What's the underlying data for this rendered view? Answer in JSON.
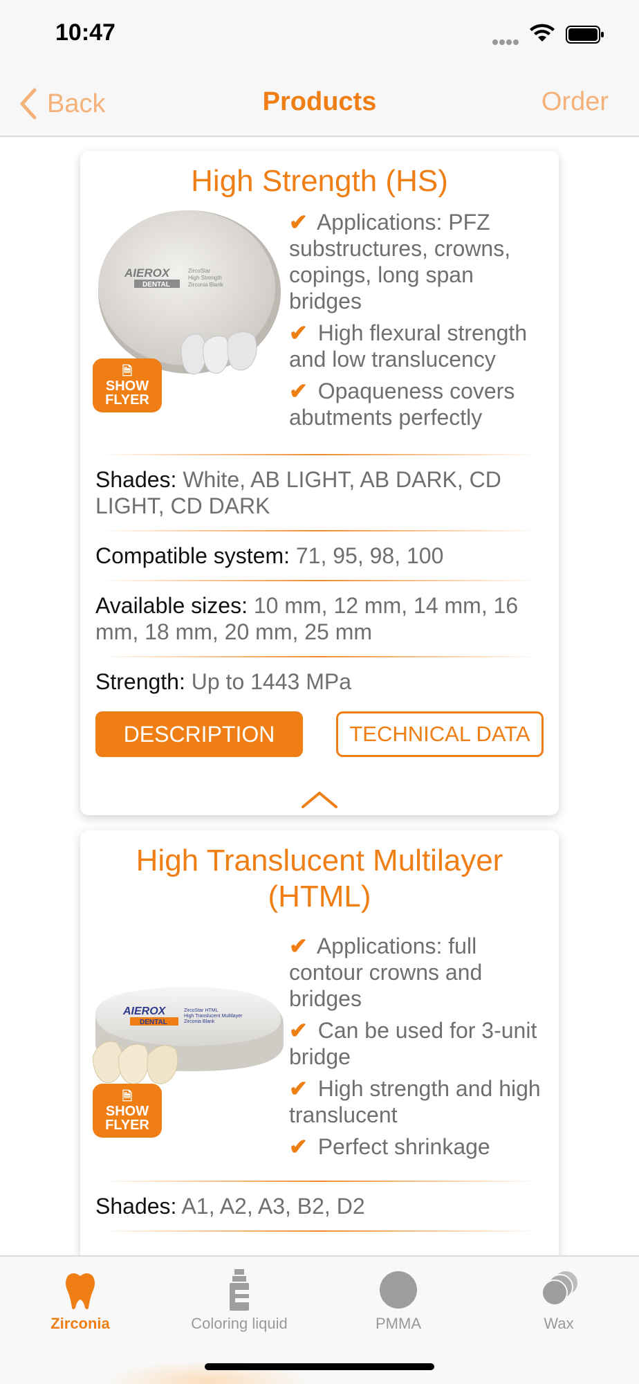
{
  "status_bar": {
    "time": "10:47"
  },
  "nav": {
    "back_label": "Back",
    "title": "Products",
    "order_label": "Order"
  },
  "colors": {
    "accent": "#ef7e14",
    "accent_light": "#f4b27a",
    "muted_text": "#6f6f6f"
  },
  "products": [
    {
      "title": "High Strength (HS)",
      "features": [
        "Applications: PFZ substructures, crowns, copings, long span bridges",
        "High flexural strength and low translucency",
        "Opaqueness covers abutments perfectly"
      ],
      "flyer_label": [
        "SHOW",
        "FLYER"
      ],
      "image_text": {
        "brand": "AIEROX",
        "sub": "DENTAL",
        "lines": [
          "ZircoStar",
          "High Strength",
          "Zirconia Blank"
        ]
      },
      "specs": [
        {
          "label": "Shades:",
          "value": "White, AB LIGHT, AB DARK, CD LIGHT, CD DARK"
        },
        {
          "label": "Compatible system:",
          "value": "71, 95, 98, 100"
        },
        {
          "label": "Available sizes:",
          "value": "10 mm, 12 mm, 14 mm, 16 mm, 18 mm, 20 mm, 25 mm"
        },
        {
          "label": "Strength:",
          "value": "Up to 1443 MPa"
        }
      ],
      "description_label": "DESCRIPTION",
      "technical_label": "TECHNICAL DATA"
    },
    {
      "title": "High Translucent Multilayer (HTML)",
      "features": [
        "Applications: full contour crowns and bridges",
        "Can be used for 3-unit bridge",
        "High strength and high translucent",
        "Perfect shrinkage"
      ],
      "flyer_label": [
        "SHOW",
        "FLYER"
      ],
      "image_text": {
        "brand": "AIEROX",
        "sub": "DENTAL",
        "lines": [
          "ZircoStar HTML",
          "High Translucent Multilayer",
          "Zirconia Blank"
        ]
      },
      "specs": [
        {
          "label": "Shades:",
          "value": "A1, A2, A3, B2, D2"
        }
      ]
    }
  ],
  "tabs": [
    {
      "label": "Zirconia",
      "icon": "tooth-icon",
      "active": true
    },
    {
      "label": "Coloring liquid",
      "icon": "bottle-icon",
      "active": false
    },
    {
      "label": "PMMA",
      "icon": "disc-icon",
      "active": false
    },
    {
      "label": "Wax",
      "icon": "wax-discs-icon",
      "active": false
    }
  ]
}
